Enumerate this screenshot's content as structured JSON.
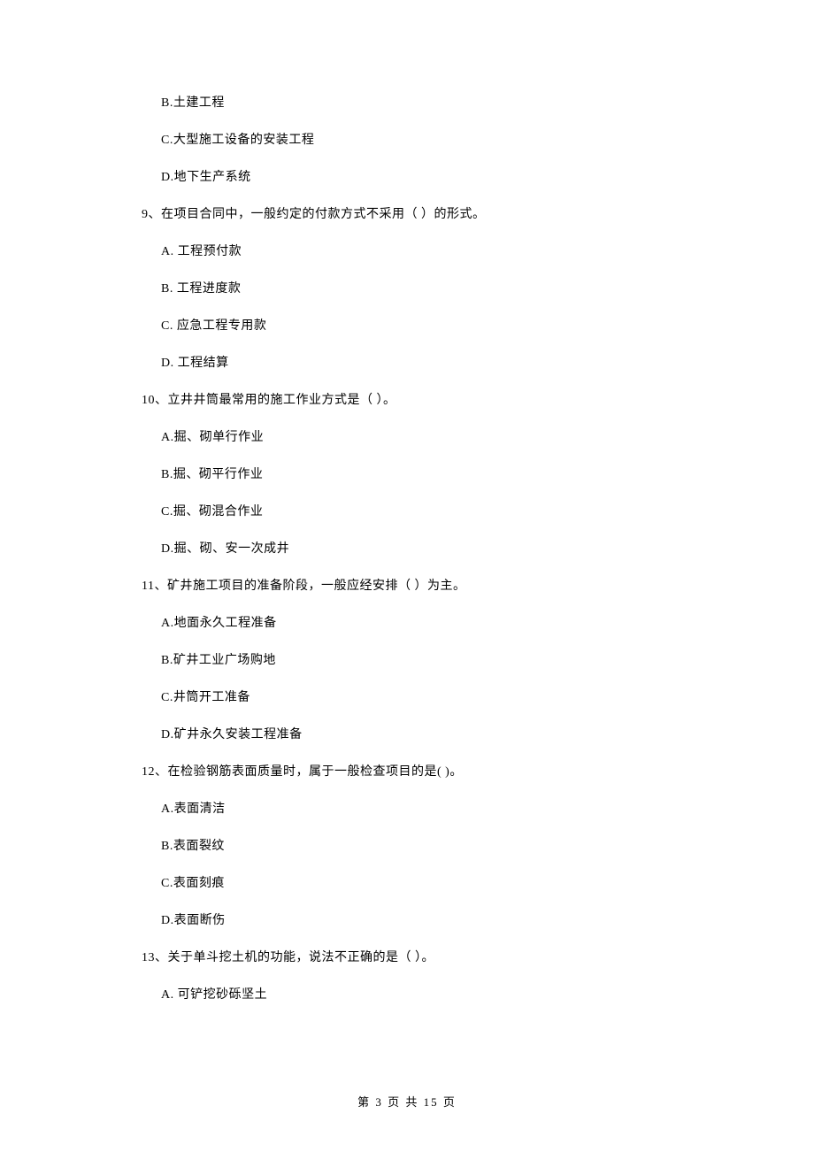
{
  "previous_options": [
    "B.土建工程",
    "C.大型施工设备的安装工程",
    "D.地下生产系统"
  ],
  "questions": [
    {
      "stem": "9、在项目合同中，一般约定的付款方式不采用（    ）的形式。",
      "options": [
        "A. 工程预付款",
        "B. 工程进度款",
        "C. 应急工程专用款",
        "D. 工程结算"
      ]
    },
    {
      "stem": "10、立井井筒最常用的施工作业方式是（    ）。",
      "options": [
        "A.掘、砌单行作业",
        "B.掘、砌平行作业",
        "C.掘、砌混合作业",
        "D.掘、砌、安一次成井"
      ]
    },
    {
      "stem": "11、矿井施工项目的准备阶段，一般应经安排（    ）为主。",
      "options": [
        "A.地面永久工程准备",
        "B.矿井工业广场购地",
        "C.井筒开工准备",
        "D.矿井永久安装工程准备"
      ]
    },
    {
      "stem": "12、在检验钢筋表面质量时，属于一般检查项目的是(    )。",
      "options": [
        "A.表面清洁",
        "B.表面裂纹",
        "C.表面刻痕",
        "D.表面断伤"
      ]
    },
    {
      "stem": "13、关于单斗挖土机的功能，说法不正确的是（    ）。",
      "options": [
        "A. 可铲挖砂砾坚土"
      ]
    }
  ],
  "footer": "第 3 页 共 15 页"
}
